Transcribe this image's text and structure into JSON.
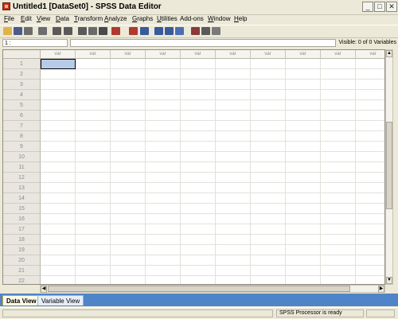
{
  "window": {
    "title": "Untitled1 [DataSet0] - SPSS Data Editor",
    "minimize_label": "_",
    "maximize_label": "□",
    "close_label": "✕"
  },
  "menu": {
    "items": [
      {
        "first": "F",
        "rest": "ile"
      },
      {
        "first": "E",
        "rest": "dit"
      },
      {
        "first": "V",
        "rest": "iew"
      },
      {
        "first": "D",
        "rest": "ata"
      },
      {
        "first": "T",
        "rest": "ransform"
      },
      {
        "first": "A",
        "rest": "nalyze"
      },
      {
        "first": "G",
        "rest": "raphs"
      },
      {
        "first": "U",
        "rest": "tilities"
      },
      {
        "first": "",
        "rest": "Add-ons"
      },
      {
        "first": "W",
        "rest": "indow"
      },
      {
        "first": "H",
        "rest": "elp"
      }
    ]
  },
  "toolbar": {
    "icons": [
      "open-icon",
      "save-icon",
      "print-icon",
      "dialog-recall-icon",
      "undo-icon",
      "redo-icon",
      "goto-case-icon",
      "variables-icon",
      "find-icon",
      "insert-cases-icon",
      "insert-variable-icon",
      "split-file-icon",
      "weight-cases-icon",
      "select-cases-icon",
      "value-labels-icon",
      "use-sets-icon",
      "show-all-icon",
      "spell-icon"
    ]
  },
  "cell_editor": {
    "reference": "1 :",
    "value": "",
    "visible_info": "Visible: 0 of 0 Variables"
  },
  "grid": {
    "column_header": "var",
    "column_count": 10,
    "rows": [
      "1",
      "2",
      "3",
      "4",
      "5",
      "6",
      "7",
      "8",
      "9",
      "10",
      "11",
      "12",
      "13",
      "14",
      "15",
      "16",
      "17",
      "18",
      "19",
      "20",
      "21",
      "22"
    ],
    "selected": {
      "row": 1,
      "column": 1
    }
  },
  "tabs": [
    {
      "label": "Data View",
      "active": true
    },
    {
      "label": "Variable View",
      "active": false
    }
  ],
  "status": {
    "processor": "SPSS  Processor is ready"
  },
  "colors": {
    "accent": "#4f84c9",
    "selection": "#b6cbe7",
    "chrome": "#ece9d8"
  }
}
